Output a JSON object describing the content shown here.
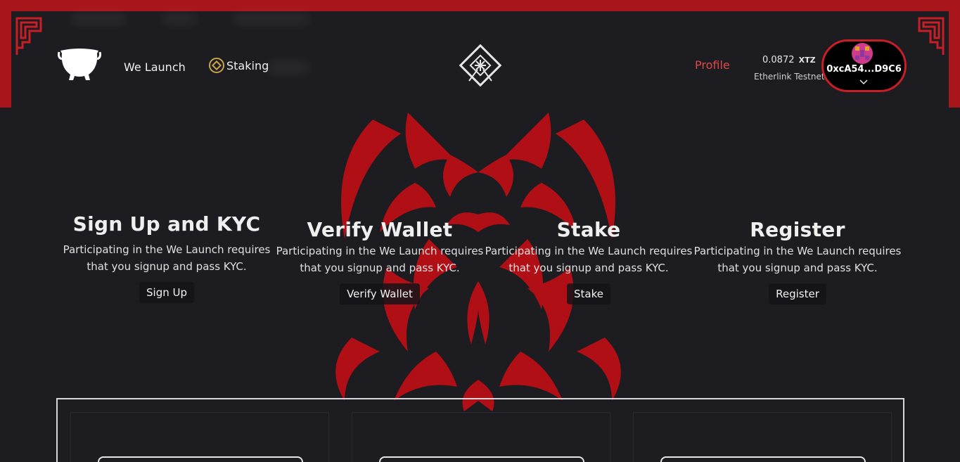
{
  "nav": {
    "we_launch": "We Launch",
    "staking": "Staking",
    "profile": "Profile"
  },
  "wallet": {
    "balance": "0.0872",
    "currency": "XTZ",
    "network": "Etherlink Testnet",
    "address": "0xcA54...D9C6"
  },
  "steps": [
    {
      "title": "Sign Up and KYC",
      "description": "Participating in the We Launch requires that you signup and pass KYC.",
      "button": "Sign Up"
    },
    {
      "title": "Verify Wallet",
      "description": "Participating in the We Launch requires that you signup and pass KYC.",
      "button": "Verify Wallet"
    },
    {
      "title": "Stake",
      "description": "Participating in the We Launch requires that you signup and pass KYC.",
      "button": "Stake"
    },
    {
      "title": "Register",
      "description": "Participating in the We Launch requires that you signup and pass KYC.",
      "button": "Register"
    }
  ],
  "colors": {
    "accent_red": "#a8161b",
    "profile_red": "#e04848",
    "background": "#1c1c21"
  },
  "icons": [
    "frame-ornament-icon",
    "pot-logo-icon",
    "staking-coin-icon",
    "diamond-emblem-icon",
    "wallet-avatar-icon",
    "chevron-down-icon"
  ]
}
